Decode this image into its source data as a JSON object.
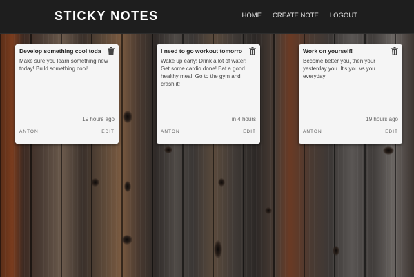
{
  "header": {
    "brand": "STICKY NOTES",
    "nav": [
      "HOME",
      "CREATE NOTE",
      "LOGOUT"
    ]
  },
  "notes": [
    {
      "title": "Develop something cool today!",
      "body": "Make sure you learn something new today! Build something cool!",
      "time": "19 hours ago",
      "author": "ANTON",
      "edit": "EDIT",
      "icon": "trash-icon"
    },
    {
      "title": "I need to go workout tomorrow.",
      "body": "Wake up early! Drink a lot of water! Get some cardio done! Eat a good healthy meal! Go to the gym and crash it!",
      "time": "in 4 hours",
      "author": "ANTON",
      "edit": "EDIT",
      "icon": "trash-icon"
    },
    {
      "title": "Work on yourself!",
      "body": "Become better you, then your yesterday you. It's you vs you everyday!",
      "time": "19 hours ago",
      "author": "ANTON",
      "edit": "EDIT",
      "icon": "trash-icon"
    }
  ],
  "colors": {
    "header_bg": "#1e1e1e",
    "card_bg": "#f5f5f5",
    "text": "#222222"
  }
}
